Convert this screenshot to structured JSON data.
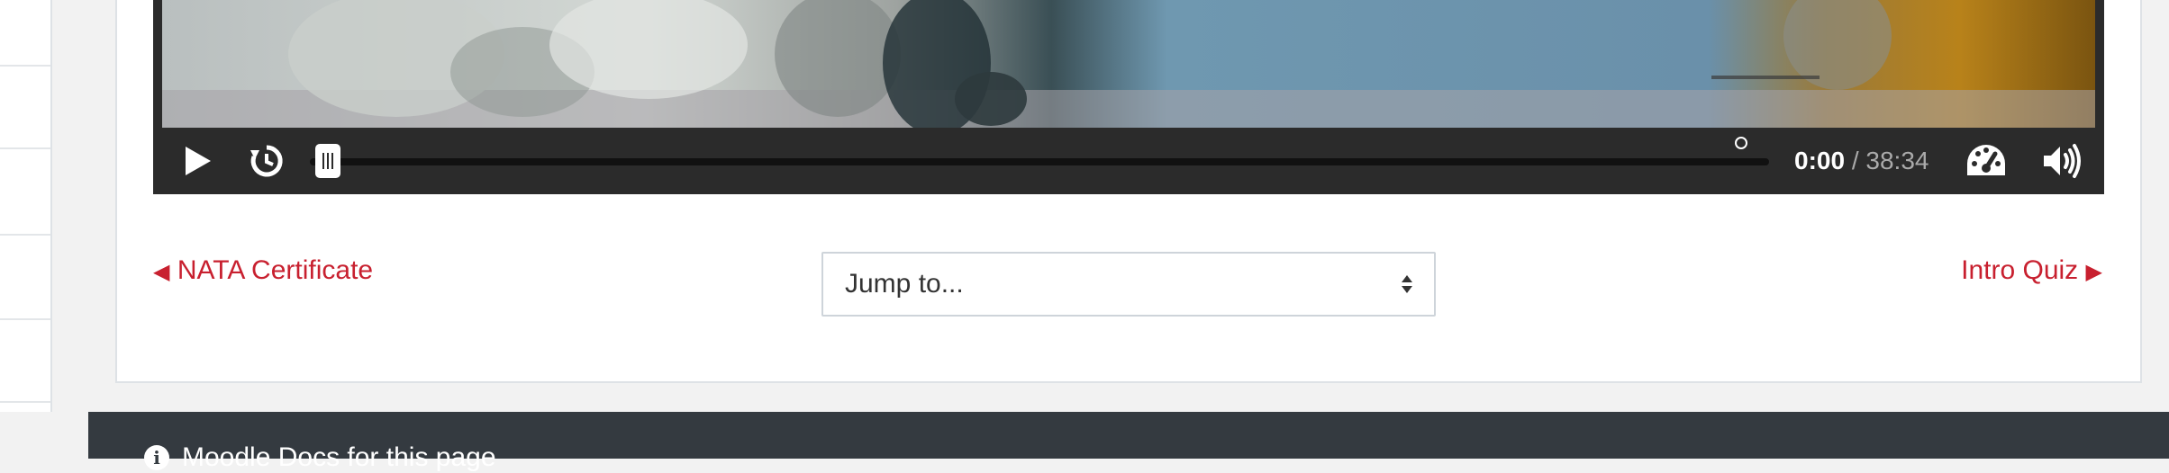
{
  "player": {
    "time_current": "0:00",
    "time_separator": " / ",
    "time_total": "38:34",
    "progress": 0.0,
    "icons": {
      "play": "play-icon",
      "restart": "restart-icon",
      "speed": "speedometer-icon",
      "volume": "volume-icon",
      "settings": "gear-icon",
      "fullscreen": "expand-icon"
    }
  },
  "navigation": {
    "prev_arrow": "◀",
    "prev_label": "NATA Certificate",
    "next_label": "Intro Quiz",
    "next_arrow": "▶",
    "jump_placeholder": "Jump to..."
  },
  "footer": {
    "docs_link": "Moodle Docs for this page"
  },
  "colors": {
    "accent": "#c8202f",
    "footer_bg": "#343a40",
    "player_bg": "#2b2b2b"
  }
}
